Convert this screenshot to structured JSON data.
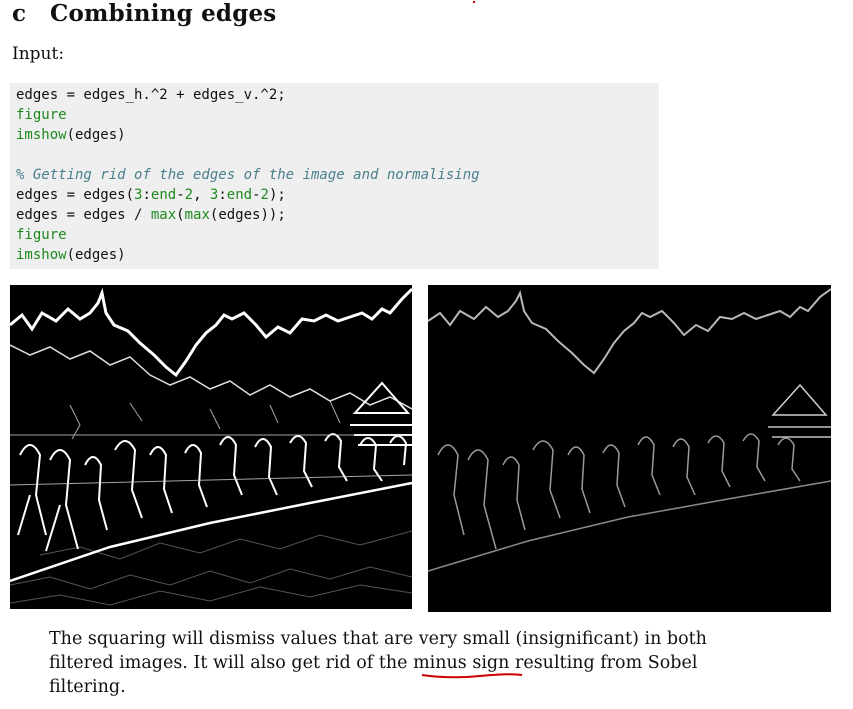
{
  "section": {
    "letter": "c",
    "title": "Combining edges"
  },
  "input_label": "Input:",
  "code": {
    "l1": {
      "a": "edges = edges_h.^2 + edges_v.^2;"
    },
    "l2": {
      "kw": "figure"
    },
    "l3": {
      "kw": "imshow",
      "rest": "(edges)"
    },
    "l5": {
      "comment": "% Getting rid of the edges of the image and normalising"
    },
    "l6": {
      "a": "edges = edges(",
      "n1": "3",
      "b": ":",
      "k1": "end",
      "c": "-",
      "n2": "2",
      "d": ", ",
      "n3": "3",
      "e": ":",
      "k2": "end",
      "f": "-",
      "n4": "2",
      "g": ");"
    },
    "l7": {
      "a": "edges = edges / ",
      "k1": "max",
      "b": "(",
      "k2": "max",
      "c": "(edges));"
    },
    "l8": {
      "kw": "figure"
    },
    "l9": {
      "kw": "imshow",
      "rest": "(edges)"
    }
  },
  "caption": {
    "before": "The squaring will dismiss values that are very small (insignificant) in both filtered images.  It will also get rid of the ",
    "highlight": "minus sign",
    "after": " resulting from Sobel filtering."
  },
  "colors": {
    "keyword": "#1e8a1e",
    "comment": "#4a7f8c",
    "annotation": "#cc0000",
    "code_bg": "#efefef"
  }
}
